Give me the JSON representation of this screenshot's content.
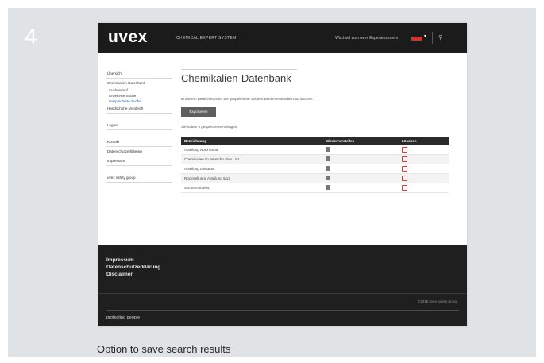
{
  "slide": {
    "step_number": "4",
    "caption": "Option to save search results"
  },
  "header": {
    "logo": "uvex",
    "site_name": "CHEMICAL EXPERT SYSTEM",
    "top_link": "Wechsel zum uvex Expertensystem",
    "lang_caret": "▾",
    "user_glyph": "⚲"
  },
  "sidebar": {
    "items": [
      {
        "label": "Übersicht",
        "type": "item"
      },
      {
        "label": "Chemikalien-Datenbank",
        "type": "item-head"
      },
      {
        "label": "Suchverlauf",
        "type": "sub"
      },
      {
        "label": "Erweiterte Suche",
        "type": "sub"
      },
      {
        "label": "Gespeicherte Suche",
        "type": "sub-active"
      },
      {
        "label": "Handschuhe-Vergleich",
        "type": "item"
      },
      {
        "label": "Logout",
        "type": "item-gap"
      },
      {
        "label": "Kontakt",
        "type": "item-gap"
      },
      {
        "label": "Datenschutzerklärung",
        "type": "item"
      },
      {
        "label": "Impressum",
        "type": "item"
      },
      {
        "label": "uvex safety group",
        "type": "item-gap"
      }
    ]
  },
  "main": {
    "title": "Chemikalien-Datenbank",
    "intro": "In diesem Bereich können Sie gespeicherte Suchen wiederverwenden und löschen.",
    "export_button": "Exportieren",
    "count_text": "Sie haben 5 gespeicherte Anfragen.",
    "table": {
      "headers": [
        "Bezeichnung",
        "Wiederherstellen",
        "Löschen"
      ],
      "rows": [
        {
          "name": "Abteilung Nord 04/05"
        },
        {
          "name": "Chemikalien im Bereich Labor Linz"
        },
        {
          "name": "Abteilung 03/03/05"
        },
        {
          "name": "Rückstellungs Abteilung 5/12"
        },
        {
          "name": "Suche 07/09/05"
        }
      ]
    }
  },
  "footer": {
    "links": [
      "Impressum",
      "Datenschutzerklärung",
      "Disclaimer"
    ],
    "copyright": "©2015 uvex safety group",
    "tagline": "protecting people"
  },
  "colors": {
    "background": "#dfe3e6",
    "header": "#1b1b1b",
    "accent_red": "#d23a3a",
    "link_blue": "#1e5aa8"
  }
}
